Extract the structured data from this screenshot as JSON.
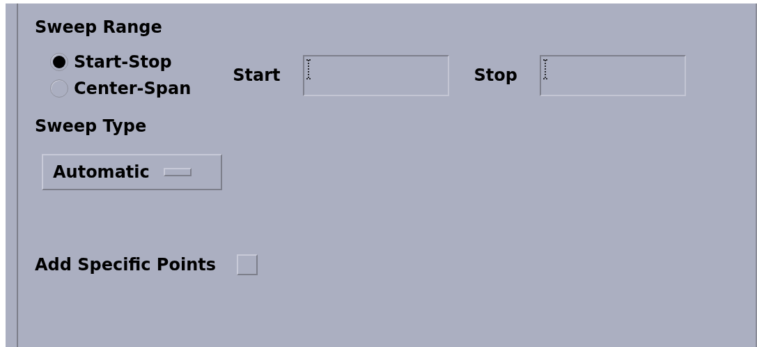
{
  "sweep_range": {
    "title": "Sweep Range",
    "options": [
      {
        "label": "Start-Stop",
        "selected": true
      },
      {
        "label": "Center-Span",
        "selected": false
      }
    ],
    "fields": [
      {
        "label": "Start"
      },
      {
        "label": "Stop"
      }
    ]
  },
  "sweep_type": {
    "title": "Sweep Type",
    "value": "Automatic"
  },
  "add_specific_points": {
    "label": "Add Specific Points",
    "checked": false
  }
}
